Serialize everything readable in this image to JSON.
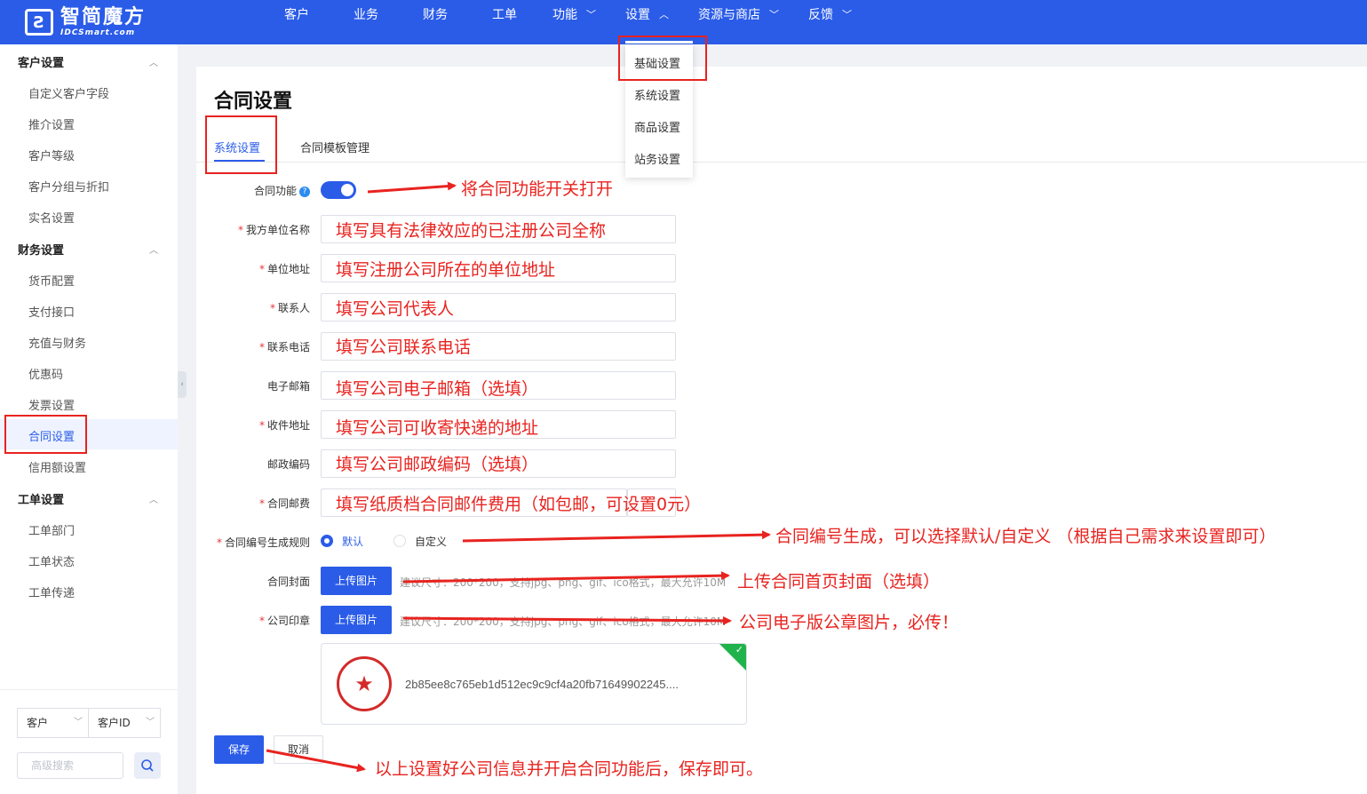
{
  "app": {
    "logo_cn": "智简魔方",
    "logo_en": "IDCSmart.com",
    "accent_color": "#2b5ce8",
    "annotation_color": "#e8231f"
  },
  "topnav": {
    "items": [
      {
        "label": "客户",
        "has_chevron": false
      },
      {
        "label": "业务",
        "has_chevron": false
      },
      {
        "label": "财务",
        "has_chevron": false
      },
      {
        "label": "工单",
        "has_chevron": false
      },
      {
        "label": "功能",
        "has_chevron": true
      },
      {
        "label": "设置",
        "has_chevron": true,
        "active": true
      },
      {
        "label": "资源与商店",
        "has_chevron": true
      },
      {
        "label": "反馈",
        "has_chevron": true
      }
    ],
    "dropdown": [
      "基础设置",
      "系统设置",
      "商品设置",
      "站务设置"
    ]
  },
  "sidebar": {
    "groups": [
      {
        "title": "客户设置",
        "items": [
          "自定义客户字段",
          "推介设置",
          "客户等级",
          "客户分组与折扣",
          "实名设置"
        ]
      },
      {
        "title": "财务设置",
        "items": [
          "货币配置",
          "支付接口",
          "充值与财务",
          "优惠码",
          "发票设置",
          "合同设置",
          "信用额设置"
        ]
      },
      {
        "title": "工单设置",
        "items": [
          "工单部门",
          "工单状态",
          "工单传递"
        ]
      }
    ],
    "active_item": "合同设置",
    "search_type": "客户",
    "search_field": "客户ID",
    "search_placeholder": "高级搜索"
  },
  "main": {
    "title": "合同设置",
    "tabs": [
      "系统设置",
      "合同模板管理"
    ],
    "active_tab": "系统设置",
    "form": {
      "contract_toggle_label": "合同功能",
      "contract_toggle_on": true,
      "fields": [
        {
          "label": "我方单位名称",
          "required": true,
          "annotation": "填写具有法律效应的已注册公司全称"
        },
        {
          "label": "单位地址",
          "required": true,
          "annotation": "填写注册公司所在的单位地址"
        },
        {
          "label": "联系人",
          "required": true,
          "annotation": "填写公司代表人"
        },
        {
          "label": "联系电话",
          "required": true,
          "annotation": "填写公司联系电话"
        },
        {
          "label": "电子邮箱",
          "required": false,
          "annotation": "填写公司电子邮箱（选填）"
        },
        {
          "label": "收件地址",
          "required": true,
          "annotation": "填写公司可收寄快递的地址"
        },
        {
          "label": "邮政编码",
          "required": false,
          "annotation": "填写公司邮政编码（选填）"
        },
        {
          "label": "合同邮费",
          "required": true,
          "annotation": "填写纸质档合同邮件费用（如包邮，可设置0元）"
        }
      ],
      "numbering_rule_label": "合同编号生成规则",
      "numbering_options": [
        "默认",
        "自定义"
      ],
      "numbering_selected": "默认",
      "cover_label": "合同封面",
      "seal_label": "公司印章",
      "upload_button": "上传图片",
      "upload_hint": "建议尺寸：200*200，支持jpg、png、gif、ico格式，最大允许10M",
      "uploaded_file": "2b85ee8c765eb1d512ec9c9cf4a20fb71649902245....",
      "save_button": "保存",
      "cancel_button": "取消"
    }
  },
  "annotations": {
    "toggle": "将合同功能开关打开",
    "numbering": "合同编号生成，可以选择默认/自定义 （根据自己需求来设置即可）",
    "cover": "上传合同首页封面（选填）",
    "seal": "公司电子版公章图片，必传！",
    "save": "以上设置好公司信息并开启合同功能后，保存即可。"
  }
}
